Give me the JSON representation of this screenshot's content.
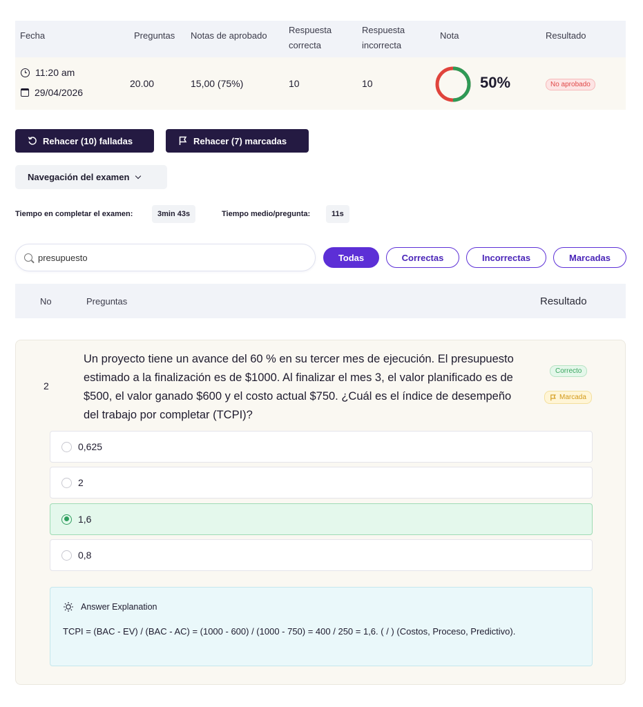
{
  "summary": {
    "headers": {
      "fecha": "Fecha",
      "preguntas": "Preguntas",
      "notas_aprobado": "Notas de aprobado",
      "resp_correcta_l1": "Respuesta",
      "resp_correcta_l2": "correcta",
      "resp_incorrecta_l1": "Respuesta",
      "resp_incorrecta_l2": "incorrecta",
      "nota": "Nota",
      "resultado": "Resultado"
    },
    "row": {
      "time": "11:20 am",
      "date": "29/04/2026",
      "preguntas": "20.00",
      "notas_aprobado": "15,00 (75%)",
      "correctas": "10",
      "incorrectas": "10",
      "nota_pct": "50%",
      "nota_fraction": 0.5,
      "resultado": "No aprobado"
    },
    "colors": {
      "gauge_correct": "#2e9a56",
      "gauge_wrong": "#e0443c"
    }
  },
  "actions": {
    "retry_failed": "Rehacer (10) falladas",
    "retry_marked": "Rehacer (7) marcadas"
  },
  "navigation": {
    "label": "Navegación del examen"
  },
  "timing": {
    "total_label": "Tiempo en completar el examen:",
    "total_value": "3min 43s",
    "avg_label": "Tiempo medio/pregunta:",
    "avg_value": "11s"
  },
  "search": {
    "value": "presupuesto"
  },
  "filters": [
    "Todas",
    "Correctas",
    "Incorrectas",
    "Marcadas"
  ],
  "questions_header": {
    "no": "No",
    "preguntas": "Preguntas",
    "resultado": "Resultado"
  },
  "question": {
    "number": "2",
    "text": "Un proyecto tiene un avance del 60 % en su tercer mes de ejecución. El presupuesto estimado a la finalización es de $1000. Al finalizar el mes 3, el valor planificado es de $500, el valor ganado $600 y el costo actual $750. ¿Cuál es el índice de desempeño del trabajo por completar (TCPI)?",
    "status": "Correcto",
    "flag": "Marcada",
    "options": [
      "0,625",
      "2",
      "1,6",
      "0,8"
    ],
    "selected_index": 2,
    "explanation_title": "Answer Explanation",
    "explanation": "TCPI = (BAC - EV) / (BAC - AC) = (1000 - 600) / (1000 - 750) = 400 / 250 = 1,6. ( / ) (Costos, Proceso, Predictivo)."
  }
}
